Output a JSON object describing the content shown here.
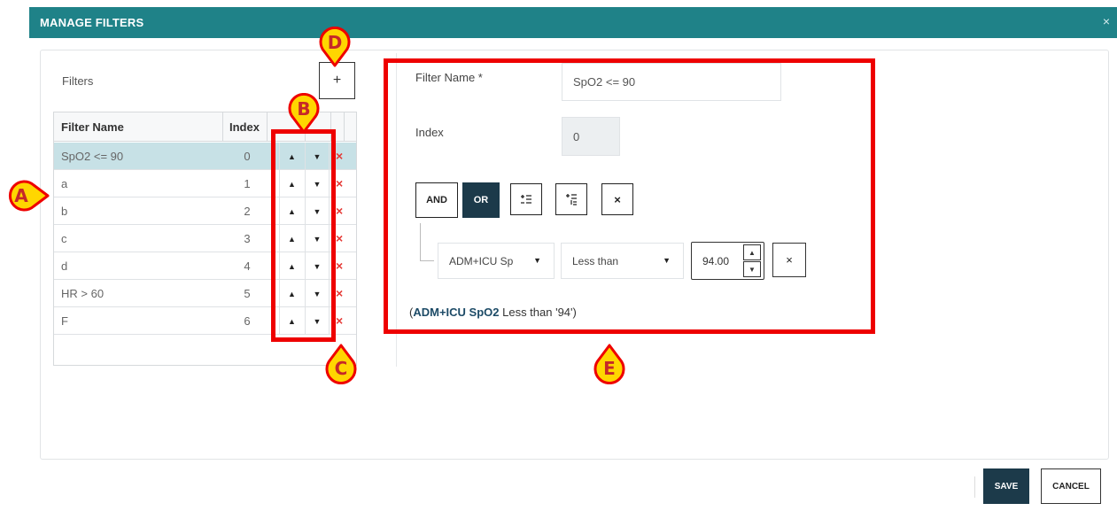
{
  "dialog": {
    "title": "MANAGE FILTERS",
    "close_label": "×"
  },
  "filters_panel": {
    "label": "Filters",
    "add_label": "+",
    "columns": [
      "Filter Name",
      "Index"
    ],
    "rows": [
      {
        "name": "SpO2 <= 90",
        "index": "0"
      },
      {
        "name": "a",
        "index": "1"
      },
      {
        "name": "b",
        "index": "2"
      },
      {
        "name": "c",
        "index": "3"
      },
      {
        "name": "d",
        "index": "4"
      },
      {
        "name": "HR > 60",
        "index": "5"
      },
      {
        "name": "F",
        "index": "6"
      }
    ],
    "selected_row": 0,
    "up_glyph": "▲",
    "down_glyph": "▼",
    "delete_glyph": "×"
  },
  "editor": {
    "filter_name_label": "Filter Name *",
    "filter_name_value": "SpO2 <= 90",
    "index_label": "Index",
    "index_value": "0",
    "and_label": "AND",
    "or_label": "OR",
    "add_condition_icon": "add-condition-icon",
    "add_group_icon": "add-group-icon",
    "remove_label": "×",
    "condition": {
      "field": "ADM+ICU Sp",
      "operator": "Less than",
      "value": "94.00",
      "remove_label": "×"
    },
    "summary": {
      "open": "(",
      "field": "ADM+ICU SpO2",
      "rest": " Less than '94')"
    }
  },
  "annotations": {
    "a": "A",
    "b": "B",
    "c": "C",
    "d": "D",
    "e": "E",
    "marker_color": "#ffd600",
    "highlight_color": "#ee0000"
  },
  "footer": {
    "save_label": "SAVE",
    "cancel_label": "CANCEL"
  },
  "colors": {
    "header": "#1f8288",
    "primary_button": "#1c3a4a",
    "selected_row": "#c7e1e6",
    "delete": "#e53935"
  }
}
